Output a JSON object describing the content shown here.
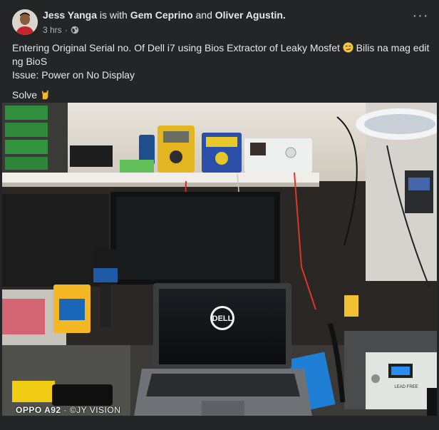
{
  "author": {
    "name": "Jess Yanga",
    "connector": "is with",
    "tag1": "Gem Ceprino",
    "and": "and",
    "tag2": "Oliver Agustin."
  },
  "meta": {
    "time": "3 hrs",
    "sep": "·"
  },
  "menu": {
    "label": "···"
  },
  "post": {
    "line1_a": "Entering Original Serial no. Of Dell i7 using Bios Extractor of Leaky Mosfet",
    "line1_b": "Bilis na mag edit ng BioS",
    "line2": "Issue: Power on No Display",
    "line3": "Solve"
  },
  "photo": {
    "laptop_brand": "DELL",
    "watermark_device": "OPPO A92",
    "watermark_sep": " · ",
    "watermark_author": "©JY VISION",
    "station_label": "LEAD FREE"
  },
  "icons": {
    "globe": "globe-icon",
    "emoji1": "smirk-emoji",
    "emoji2": "rock-on-emoji",
    "menu": "more-options-icon"
  }
}
